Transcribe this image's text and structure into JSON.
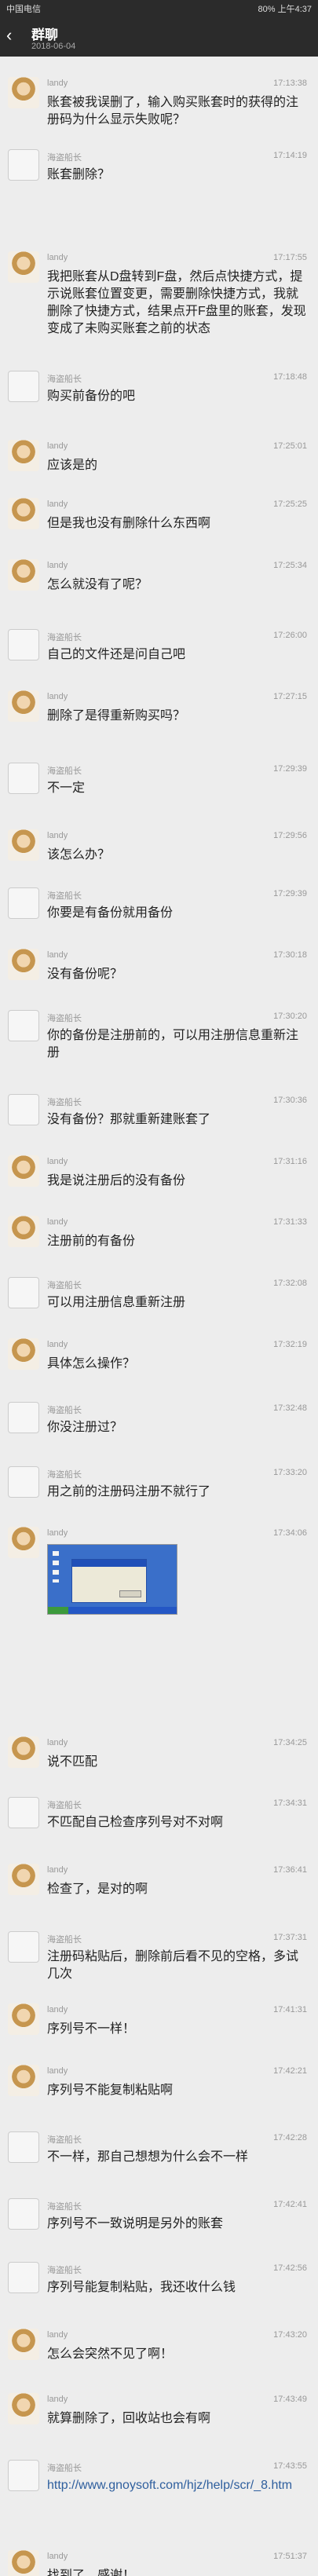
{
  "status_bar": {
    "carrier": "中国电信",
    "right": "80% 上午4:37"
  },
  "header": {
    "back_icon": "back-arrow-icon",
    "title": "群聊",
    "date": "2018-06-04"
  },
  "messages": [
    {
      "sender": "landy",
      "time": "17:13:38",
      "text": "账套被我误删了，输入购买账套时的获得的注册码为什么显示失败呢？"
    },
    {
      "sender": "海盗船长",
      "time": "17:14:19",
      "text": "账套删除？"
    },
    {
      "sender": "landy",
      "time": "17:17:55",
      "text": "我把账套从D盘转到F盘，然后点快捷方式，提示说账套位置变更，需要删除快捷方式，我就删除了快捷方式，结果点开F盘里的账套，发现变成了未购买账套之前的状态"
    },
    {
      "sender": "海盗船长",
      "time": "17:18:48",
      "text": "购买前备份的吧"
    },
    {
      "sender": "landy",
      "time": "17:25:01",
      "text": "应该是的"
    },
    {
      "sender": "landy",
      "time": "17:25:25",
      "text": "但是我也没有删除什么东西啊"
    },
    {
      "sender": "landy",
      "time": "17:25:34",
      "text": "怎么就没有了呢？"
    },
    {
      "sender": "海盗船长",
      "time": "17:26:00",
      "text": "自己的文件还是问自己吧"
    },
    {
      "sender": "landy",
      "time": "17:27:15",
      "text": "删除了是得重新购买吗？"
    },
    {
      "sender": "海盗船长",
      "time": "17:29:39",
      "text": "不一定"
    },
    {
      "sender": "landy",
      "time": "17:29:56",
      "text": "该怎么办？"
    },
    {
      "sender": "海盗船长",
      "time": "17:29:39",
      "text": "你要是有备份就用备份"
    },
    {
      "sender": "landy",
      "time": "17:30:18",
      "text": "没有备份呢？"
    },
    {
      "sender": "海盗船长",
      "time": "17:30:20",
      "text": "你的备份是注册前的，可以用注册信息重新注册"
    },
    {
      "sender": "海盗船长",
      "time": "17:30:36",
      "text": "没有备份？那就重新建账套了"
    },
    {
      "sender": "landy",
      "time": "17:31:16",
      "text": "我是说注册后的没有备份"
    },
    {
      "sender": "landy",
      "time": "17:31:33",
      "text": "注册前的有备份"
    },
    {
      "sender": "海盗船长",
      "time": "17:32:08",
      "text": "可以用注册信息重新注册"
    },
    {
      "sender": "landy",
      "time": "17:32:19",
      "text": "具体怎么操作？"
    },
    {
      "sender": "海盗船长",
      "time": "17:32:48",
      "text": "你没注册过？"
    },
    {
      "sender": "海盗船长",
      "time": "17:33:20",
      "text": "用之前的注册码注册不就行了"
    },
    {
      "sender": "landy",
      "time": "17:34:06",
      "image": "screenshot-thumbnail"
    },
    {
      "sender": "landy",
      "time": "17:34:25",
      "text": "说不匹配"
    },
    {
      "sender": "海盗船长",
      "time": "17:34:31",
      "text": "不匹配自己检查序列号对不对啊"
    },
    {
      "sender": "landy",
      "time": "17:36:41",
      "text": "检查了，是对的啊"
    },
    {
      "sender": "海盗船长",
      "time": "17:37:31",
      "text": "注册码粘贴后，删除前后看不见的空格，多试几次"
    },
    {
      "sender": "landy",
      "time": "17:41:31",
      "text": "序列号不一样！"
    },
    {
      "sender": "landy",
      "time": "17:42:21",
      "text": "序列号不能复制粘贴啊"
    },
    {
      "sender": "海盗船长",
      "time": "17:42:28",
      "text": "不一样，那自己想想为什么会不一样"
    },
    {
      "sender": "海盗船长",
      "time": "17:42:41",
      "text": "序列号不一致说明是另外的账套"
    },
    {
      "sender": "海盗船长",
      "time": "17:42:56",
      "text": "序列号能复制粘贴，我还收什么钱"
    },
    {
      "sender": "landy",
      "time": "17:43:20",
      "text": "怎么会突然不见了啊！"
    },
    {
      "sender": "landy",
      "time": "17:43:49",
      "text": "就算删除了，回收站也会有啊"
    },
    {
      "sender": "海盗船长",
      "time": "17:43:55",
      "text": "http://www.gnoysoft.com/hjz/help/scr/_8.htm",
      "is_link": true
    },
    {
      "sender": "landy",
      "time": "17:51:37",
      "text": "找到了，感谢！"
    }
  ]
}
